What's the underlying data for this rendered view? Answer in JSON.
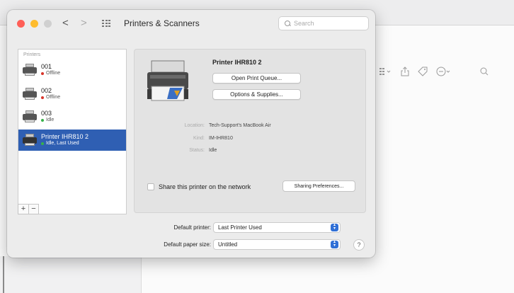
{
  "window": {
    "title": "Printers & Scanners",
    "back_glyph": "<",
    "forward_glyph": ">"
  },
  "search": {
    "placeholder": "Search"
  },
  "printer_list": {
    "header": "Printers",
    "items": [
      {
        "name": "001",
        "status": "Offline",
        "status_color": "#d8342a",
        "selected": false
      },
      {
        "name": "002",
        "status": "Offline",
        "status_color": "#d8342a",
        "selected": false
      },
      {
        "name": "003",
        "status": "Idle",
        "status_color": "#38b24a",
        "selected": false
      },
      {
        "name": "Printer IHR810 2",
        "status": "Idle, Last Used",
        "status_color": "#38b24a",
        "selected": true
      }
    ],
    "add_label": "+",
    "remove_label": "−"
  },
  "details": {
    "printer_name": "Printer IHR810 2",
    "open_queue_label": "Open Print Queue...",
    "options_label": "Options & Supplies...",
    "location_label": "Location:",
    "location_value": "Tech-Support's MacBook Air",
    "kind_label": "Kind:",
    "kind_value": "IM-IHR810",
    "status_label": "Status:",
    "status_value": "Idle",
    "share_label": "Share this printer on the network",
    "sharing_prefs_label": "Sharing Preferences..."
  },
  "defaults": {
    "default_printer_label": "Default printer:",
    "default_printer_value": "Last Printer Used",
    "paper_size_label": "Default paper size:",
    "paper_size_value": "Untitled",
    "help_label": "?"
  },
  "colors": {
    "selection": "#2f5fb3",
    "select_arrow": "#2f6fd6"
  }
}
